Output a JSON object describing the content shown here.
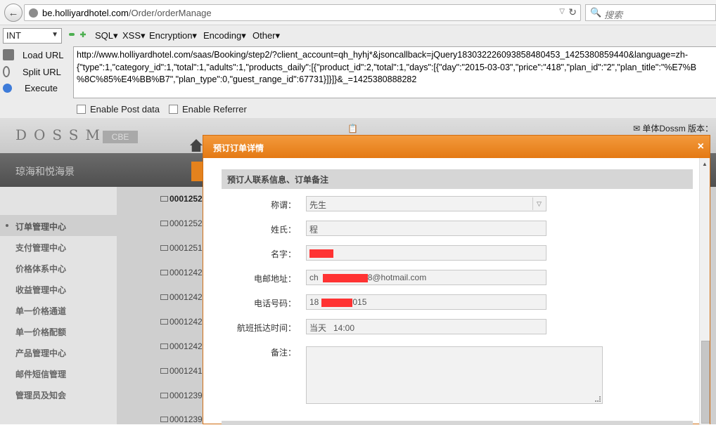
{
  "browser": {
    "url_host": "be.holliyardhotel.com",
    "url_path": "/Order/orderManage",
    "search_placeholder": "搜索"
  },
  "hackbar": {
    "type_select": "INT",
    "menus": [
      "SQL▾",
      "XSS▾",
      "Encryption▾",
      "Encoding▾",
      "Other▾"
    ],
    "load_url": "Load URL",
    "split_url": "Split URL",
    "execute": "Execute",
    "url_line1": "http://www.holliyardhotel.com/saas/Booking/step2/?client_account=qh_hyhj*&jsoncallback=jQuery183032226093858480453_1425380859440&language=zh-",
    "url_line2": "{\"type\":1,\"category_id\":1,\"total\":1,\"adults\":1,\"products_daily\":[{\"product_id\":2,\"total\":1,\"days\":[{\"day\":\"2015-03-03\",\"price\":\"418\",\"plan_id\":\"2\",\"plan_title\":\"%E7%B",
    "url_line3": "%8C%85%E4%BB%B7\",\"plan_type\":0,\"guest_range_id\":67731}]}]}&_=1425380888282",
    "enable_post": "Enable Post data",
    "enable_referrer": "Enable Referrer"
  },
  "site": {
    "logo": "DOSSM",
    "cbe": "CBE",
    "hotel_name": "琼海和悦海景",
    "version": "单体Dossm 版本："
  },
  "sidebar": {
    "items": [
      "订单管理中心",
      "支付管理中心",
      "价格体系中心",
      "收益管理中心",
      "单一价格通道",
      "单一价格配额",
      "产品管理中心",
      "邮件短信管理",
      "管理员及知会"
    ]
  },
  "orders": [
    "0001252",
    "0001252",
    "0001251",
    "0001242",
    "0001242",
    "0001242",
    "0001242",
    "0001241",
    "0001239",
    "0001239"
  ],
  "modal": {
    "title": "预订订单详情",
    "close": "×",
    "section": "预订人联系信息、订单备注",
    "fields": {
      "title_label": "称谓：",
      "title_value": "先生",
      "surname_label": "姓氏：",
      "surname_value": "程",
      "name_label": "名字：",
      "email_label": "电邮地址：",
      "email_prefix": "ch",
      "email_suffix": "8@hotmail.com",
      "phone_label": "电话号码：",
      "phone_prefix": "18",
      "phone_suffix": "015",
      "arrival_label": "航班抵达时间：",
      "arrival_value": "当天   14:00",
      "remark_label": "备注："
    }
  }
}
